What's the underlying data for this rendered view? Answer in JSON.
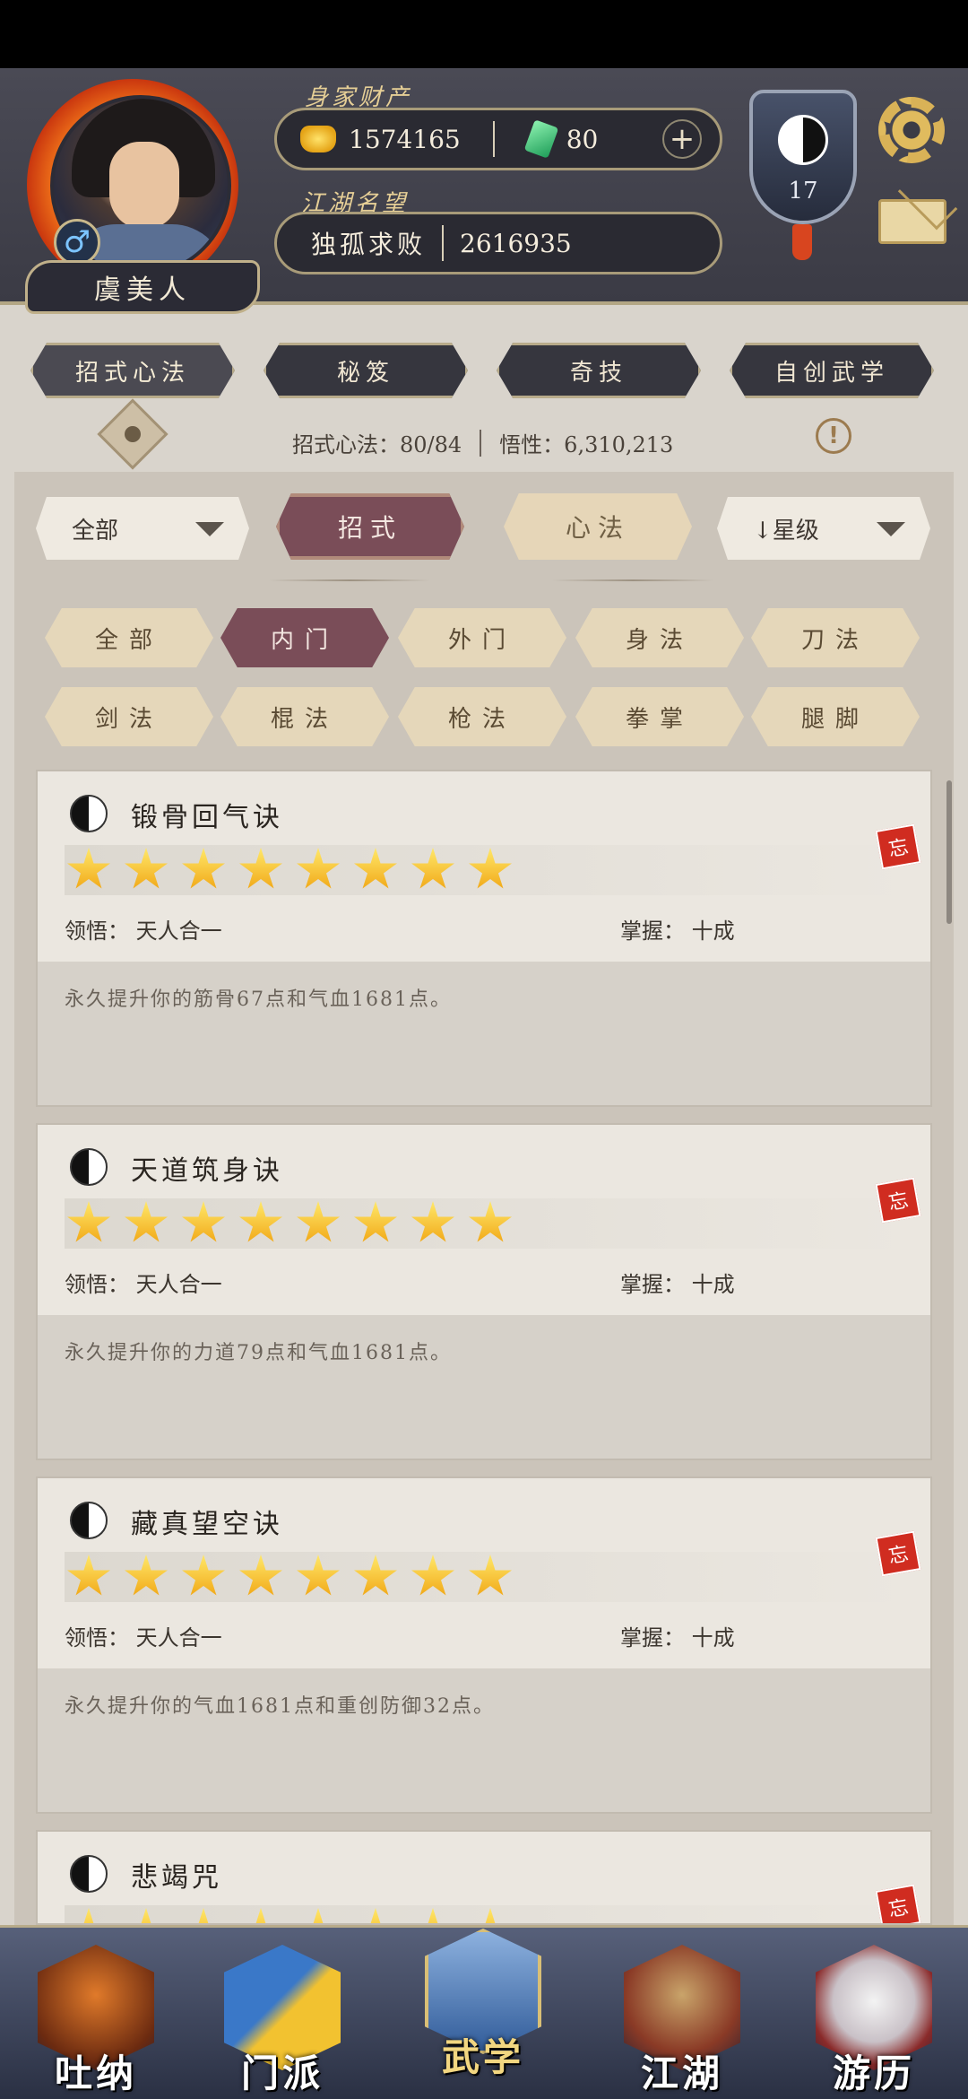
{
  "header": {
    "player_name": "虞美人",
    "wealth_label": "身家财产",
    "gold": "1574165",
    "jade": "80",
    "plus_symbol": "+",
    "fame_label": "江湖名望",
    "fame_title": "独孤求败",
    "fame_value": "2616935",
    "level": "17",
    "gender_symbol": "♂"
  },
  "top_tabs": [
    "招式心法",
    "秘笈",
    "奇技",
    "自创武学"
  ],
  "stats": {
    "skills": "招式心法：80/84",
    "insight": "悟性：6,310,213"
  },
  "info_symbol": "!",
  "filters": {
    "left_dropdown": "全部",
    "tab_moves": "招式",
    "tab_mind": "心法",
    "sort_dropdown": "↓星级"
  },
  "chips_row1": [
    "全部",
    "内门",
    "外门",
    "身法",
    "刀法"
  ],
  "chips_row2": [
    "剑法",
    "棍法",
    "枪法",
    "拳掌",
    "腿脚"
  ],
  "active_chip": "内门",
  "cards": [
    {
      "title": "锻骨回气诀",
      "stars": 8,
      "comprehension": "领悟：  天人合一",
      "mastery": "掌握：  十成",
      "desc": "永久提升你的筋骨67点和气血1681点。",
      "forget": "忘"
    },
    {
      "title": "天道筑身诀",
      "stars": 8,
      "comprehension": "领悟：  天人合一",
      "mastery": "掌握：  十成",
      "desc": "永久提升你的力道79点和气血1681点。",
      "forget": "忘"
    },
    {
      "title": "藏真望空诀",
      "stars": 8,
      "comprehension": "领悟：  天人合一",
      "mastery": "掌握：  十成",
      "desc": "永久提升你的气血1681点和重创防御32点。",
      "forget": "忘"
    },
    {
      "title": "悲竭咒",
      "stars": 8,
      "forget": "忘"
    }
  ],
  "bottom_nav": [
    "吐纳",
    "门派",
    "武学",
    "江湖",
    "游历"
  ],
  "active_nav": "武学",
  "colors": {
    "accent": "#7a4d58",
    "chip_off": "#e5d7ba",
    "header_bg": "#3b3b45"
  }
}
